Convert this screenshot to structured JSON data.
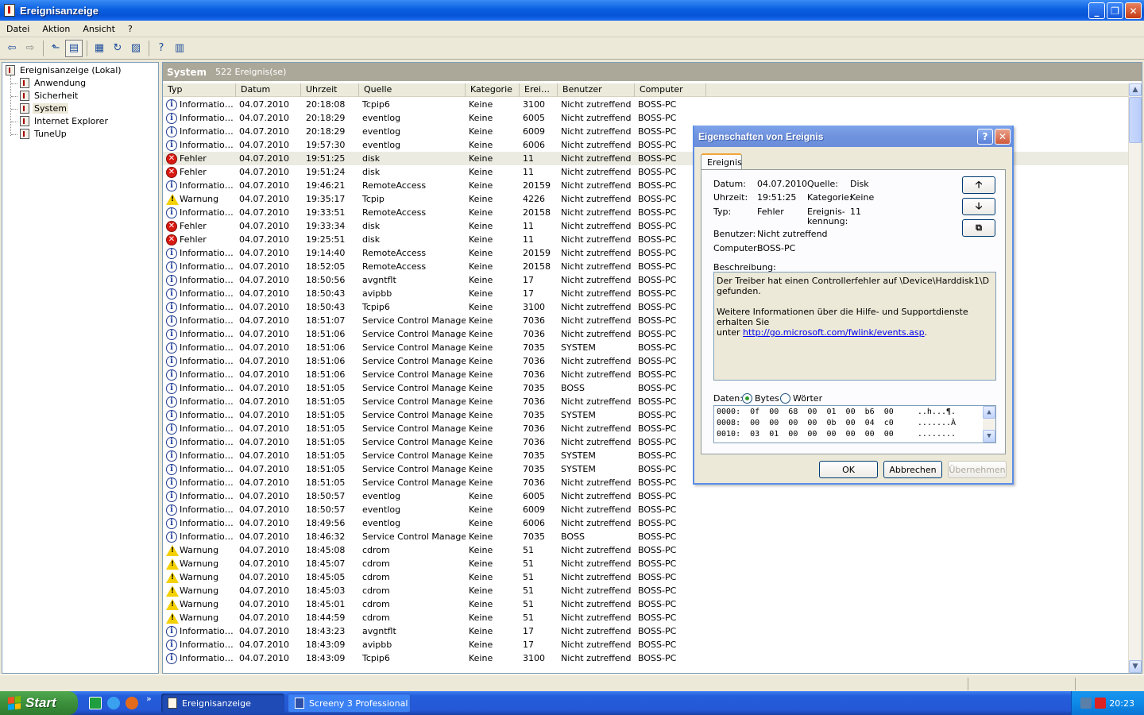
{
  "window": {
    "title": "Ereignisanzeige"
  },
  "menu": [
    "Datei",
    "Aktion",
    "Ansicht",
    "?"
  ],
  "tree": {
    "root": "Ereignisanzeige (Lokal)",
    "children": [
      "Anwendung",
      "Sicherheit",
      "System",
      "Internet Explorer",
      "TuneUp"
    ],
    "selected": "System"
  },
  "panel": {
    "name": "System",
    "count": "522 Ereignis(se)"
  },
  "columns": [
    "Typ",
    "Datum",
    "Uhrzeit",
    "Quelle",
    "Kategorie",
    "Erei…",
    "Benutzer",
    "Computer"
  ],
  "events": [
    {
      "icon": "info",
      "typ": "Informatio…",
      "datum": "04.07.2010",
      "zeit": "20:18:08",
      "quelle": "Tcpip6",
      "kat": "Keine",
      "id": "3100",
      "benutzer": "Nicht zutreffend",
      "computer": "BOSS-PC"
    },
    {
      "icon": "info",
      "typ": "Informatio…",
      "datum": "04.07.2010",
      "zeit": "20:18:29",
      "quelle": "eventlog",
      "kat": "Keine",
      "id": "6005",
      "benutzer": "Nicht zutreffend",
      "computer": "BOSS-PC"
    },
    {
      "icon": "info",
      "typ": "Informatio…",
      "datum": "04.07.2010",
      "zeit": "20:18:29",
      "quelle": "eventlog",
      "kat": "Keine",
      "id": "6009",
      "benutzer": "Nicht zutreffend",
      "computer": "BOSS-PC"
    },
    {
      "icon": "info",
      "typ": "Informatio…",
      "datum": "04.07.2010",
      "zeit": "19:57:30",
      "quelle": "eventlog",
      "kat": "Keine",
      "id": "6006",
      "benutzer": "Nicht zutreffend",
      "computer": "BOSS-PC"
    },
    {
      "icon": "err",
      "typ": "Fehler",
      "datum": "04.07.2010",
      "zeit": "19:51:25",
      "quelle": "disk",
      "kat": "Keine",
      "id": "11",
      "benutzer": "Nicht zutreffend",
      "computer": "BOSS-PC",
      "selected": true
    },
    {
      "icon": "err",
      "typ": "Fehler",
      "datum": "04.07.2010",
      "zeit": "19:51:24",
      "quelle": "disk",
      "kat": "Keine",
      "id": "11",
      "benutzer": "Nicht zutreffend",
      "computer": "BOSS-PC"
    },
    {
      "icon": "info",
      "typ": "Informatio…",
      "datum": "04.07.2010",
      "zeit": "19:46:21",
      "quelle": "RemoteAccess",
      "kat": "Keine",
      "id": "20159",
      "benutzer": "Nicht zutreffend",
      "computer": "BOSS-PC"
    },
    {
      "icon": "warn",
      "typ": "Warnung",
      "datum": "04.07.2010",
      "zeit": "19:35:17",
      "quelle": "Tcpip",
      "kat": "Keine",
      "id": "4226",
      "benutzer": "Nicht zutreffend",
      "computer": "BOSS-PC"
    },
    {
      "icon": "info",
      "typ": "Informatio…",
      "datum": "04.07.2010",
      "zeit": "19:33:51",
      "quelle": "RemoteAccess",
      "kat": "Keine",
      "id": "20158",
      "benutzer": "Nicht zutreffend",
      "computer": "BOSS-PC"
    },
    {
      "icon": "err",
      "typ": "Fehler",
      "datum": "04.07.2010",
      "zeit": "19:33:34",
      "quelle": "disk",
      "kat": "Keine",
      "id": "11",
      "benutzer": "Nicht zutreffend",
      "computer": "BOSS-PC"
    },
    {
      "icon": "err",
      "typ": "Fehler",
      "datum": "04.07.2010",
      "zeit": "19:25:51",
      "quelle": "disk",
      "kat": "Keine",
      "id": "11",
      "benutzer": "Nicht zutreffend",
      "computer": "BOSS-PC"
    },
    {
      "icon": "info",
      "typ": "Informatio…",
      "datum": "04.07.2010",
      "zeit": "19:14:40",
      "quelle": "RemoteAccess",
      "kat": "Keine",
      "id": "20159",
      "benutzer": "Nicht zutreffend",
      "computer": "BOSS-PC"
    },
    {
      "icon": "info",
      "typ": "Informatio…",
      "datum": "04.07.2010",
      "zeit": "18:52:05",
      "quelle": "RemoteAccess",
      "kat": "Keine",
      "id": "20158",
      "benutzer": "Nicht zutreffend",
      "computer": "BOSS-PC"
    },
    {
      "icon": "info",
      "typ": "Informatio…",
      "datum": "04.07.2010",
      "zeit": "18:50:56",
      "quelle": "avgntflt",
      "kat": "Keine",
      "id": "17",
      "benutzer": "Nicht zutreffend",
      "computer": "BOSS-PC"
    },
    {
      "icon": "info",
      "typ": "Informatio…",
      "datum": "04.07.2010",
      "zeit": "18:50:43",
      "quelle": "avipbb",
      "kat": "Keine",
      "id": "17",
      "benutzer": "Nicht zutreffend",
      "computer": "BOSS-PC"
    },
    {
      "icon": "info",
      "typ": "Informatio…",
      "datum": "04.07.2010",
      "zeit": "18:50:43",
      "quelle": "Tcpip6",
      "kat": "Keine",
      "id": "3100",
      "benutzer": "Nicht zutreffend",
      "computer": "BOSS-PC"
    },
    {
      "icon": "info",
      "typ": "Informatio…",
      "datum": "04.07.2010",
      "zeit": "18:51:07",
      "quelle": "Service Control Manager",
      "kat": "Keine",
      "id": "7036",
      "benutzer": "Nicht zutreffend",
      "computer": "BOSS-PC"
    },
    {
      "icon": "info",
      "typ": "Informatio…",
      "datum": "04.07.2010",
      "zeit": "18:51:06",
      "quelle": "Service Control Manager",
      "kat": "Keine",
      "id": "7036",
      "benutzer": "Nicht zutreffend",
      "computer": "BOSS-PC"
    },
    {
      "icon": "info",
      "typ": "Informatio…",
      "datum": "04.07.2010",
      "zeit": "18:51:06",
      "quelle": "Service Control Manager",
      "kat": "Keine",
      "id": "7035",
      "benutzer": "SYSTEM",
      "computer": "BOSS-PC"
    },
    {
      "icon": "info",
      "typ": "Informatio…",
      "datum": "04.07.2010",
      "zeit": "18:51:06",
      "quelle": "Service Control Manager",
      "kat": "Keine",
      "id": "7036",
      "benutzer": "Nicht zutreffend",
      "computer": "BOSS-PC"
    },
    {
      "icon": "info",
      "typ": "Informatio…",
      "datum": "04.07.2010",
      "zeit": "18:51:06",
      "quelle": "Service Control Manager",
      "kat": "Keine",
      "id": "7036",
      "benutzer": "Nicht zutreffend",
      "computer": "BOSS-PC"
    },
    {
      "icon": "info",
      "typ": "Informatio…",
      "datum": "04.07.2010",
      "zeit": "18:51:05",
      "quelle": "Service Control Manager",
      "kat": "Keine",
      "id": "7035",
      "benutzer": "BOSS",
      "computer": "BOSS-PC"
    },
    {
      "icon": "info",
      "typ": "Informatio…",
      "datum": "04.07.2010",
      "zeit": "18:51:05",
      "quelle": "Service Control Manager",
      "kat": "Keine",
      "id": "7036",
      "benutzer": "Nicht zutreffend",
      "computer": "BOSS-PC"
    },
    {
      "icon": "info",
      "typ": "Informatio…",
      "datum": "04.07.2010",
      "zeit": "18:51:05",
      "quelle": "Service Control Manager",
      "kat": "Keine",
      "id": "7035",
      "benutzer": "SYSTEM",
      "computer": "BOSS-PC"
    },
    {
      "icon": "info",
      "typ": "Informatio…",
      "datum": "04.07.2010",
      "zeit": "18:51:05",
      "quelle": "Service Control Manager",
      "kat": "Keine",
      "id": "7036",
      "benutzer": "Nicht zutreffend",
      "computer": "BOSS-PC"
    },
    {
      "icon": "info",
      "typ": "Informatio…",
      "datum": "04.07.2010",
      "zeit": "18:51:05",
      "quelle": "Service Control Manager",
      "kat": "Keine",
      "id": "7036",
      "benutzer": "Nicht zutreffend",
      "computer": "BOSS-PC"
    },
    {
      "icon": "info",
      "typ": "Informatio…",
      "datum": "04.07.2010",
      "zeit": "18:51:05",
      "quelle": "Service Control Manager",
      "kat": "Keine",
      "id": "7035",
      "benutzer": "SYSTEM",
      "computer": "BOSS-PC"
    },
    {
      "icon": "info",
      "typ": "Informatio…",
      "datum": "04.07.2010",
      "zeit": "18:51:05",
      "quelle": "Service Control Manager",
      "kat": "Keine",
      "id": "7035",
      "benutzer": "SYSTEM",
      "computer": "BOSS-PC"
    },
    {
      "icon": "info",
      "typ": "Informatio…",
      "datum": "04.07.2010",
      "zeit": "18:51:05",
      "quelle": "Service Control Manager",
      "kat": "Keine",
      "id": "7036",
      "benutzer": "Nicht zutreffend",
      "computer": "BOSS-PC"
    },
    {
      "icon": "info",
      "typ": "Informatio…",
      "datum": "04.07.2010",
      "zeit": "18:50:57",
      "quelle": "eventlog",
      "kat": "Keine",
      "id": "6005",
      "benutzer": "Nicht zutreffend",
      "computer": "BOSS-PC"
    },
    {
      "icon": "info",
      "typ": "Informatio…",
      "datum": "04.07.2010",
      "zeit": "18:50:57",
      "quelle": "eventlog",
      "kat": "Keine",
      "id": "6009",
      "benutzer": "Nicht zutreffend",
      "computer": "BOSS-PC"
    },
    {
      "icon": "info",
      "typ": "Informatio…",
      "datum": "04.07.2010",
      "zeit": "18:49:56",
      "quelle": "eventlog",
      "kat": "Keine",
      "id": "6006",
      "benutzer": "Nicht zutreffend",
      "computer": "BOSS-PC"
    },
    {
      "icon": "info",
      "typ": "Informatio…",
      "datum": "04.07.2010",
      "zeit": "18:46:32",
      "quelle": "Service Control Manager",
      "kat": "Keine",
      "id": "7035",
      "benutzer": "BOSS",
      "computer": "BOSS-PC"
    },
    {
      "icon": "warn",
      "typ": "Warnung",
      "datum": "04.07.2010",
      "zeit": "18:45:08",
      "quelle": "cdrom",
      "kat": "Keine",
      "id": "51",
      "benutzer": "Nicht zutreffend",
      "computer": "BOSS-PC"
    },
    {
      "icon": "warn",
      "typ": "Warnung",
      "datum": "04.07.2010",
      "zeit": "18:45:07",
      "quelle": "cdrom",
      "kat": "Keine",
      "id": "51",
      "benutzer": "Nicht zutreffend",
      "computer": "BOSS-PC"
    },
    {
      "icon": "warn",
      "typ": "Warnung",
      "datum": "04.07.2010",
      "zeit": "18:45:05",
      "quelle": "cdrom",
      "kat": "Keine",
      "id": "51",
      "benutzer": "Nicht zutreffend",
      "computer": "BOSS-PC"
    },
    {
      "icon": "warn",
      "typ": "Warnung",
      "datum": "04.07.2010",
      "zeit": "18:45:03",
      "quelle": "cdrom",
      "kat": "Keine",
      "id": "51",
      "benutzer": "Nicht zutreffend",
      "computer": "BOSS-PC"
    },
    {
      "icon": "warn",
      "typ": "Warnung",
      "datum": "04.07.2010",
      "zeit": "18:45:01",
      "quelle": "cdrom",
      "kat": "Keine",
      "id": "51",
      "benutzer": "Nicht zutreffend",
      "computer": "BOSS-PC"
    },
    {
      "icon": "warn",
      "typ": "Warnung",
      "datum": "04.07.2010",
      "zeit": "18:44:59",
      "quelle": "cdrom",
      "kat": "Keine",
      "id": "51",
      "benutzer": "Nicht zutreffend",
      "computer": "BOSS-PC"
    },
    {
      "icon": "info",
      "typ": "Informatio…",
      "datum": "04.07.2010",
      "zeit": "18:43:23",
      "quelle": "avgntflt",
      "kat": "Keine",
      "id": "17",
      "benutzer": "Nicht zutreffend",
      "computer": "BOSS-PC"
    },
    {
      "icon": "info",
      "typ": "Informatio…",
      "datum": "04.07.2010",
      "zeit": "18:43:09",
      "quelle": "avipbb",
      "kat": "Keine",
      "id": "17",
      "benutzer": "Nicht zutreffend",
      "computer": "BOSS-PC"
    },
    {
      "icon": "info",
      "typ": "Informatio…",
      "datum": "04.07.2010",
      "zeit": "18:43:09",
      "quelle": "Tcpip6",
      "kat": "Keine",
      "id": "3100",
      "benutzer": "Nicht zutreffend",
      "computer": "BOSS-PC"
    }
  ],
  "dialog": {
    "title": "Eigenschaften von Ereignis",
    "help_glyph": "?",
    "close_glyph": "✕",
    "tab": "Ereignis",
    "labels": {
      "datum": "Datum:",
      "uhrzeit": "Uhrzeit:",
      "typ": "Typ:",
      "benutzer": "Benutzer:",
      "computer": "Computer:",
      "quelle": "Quelle:",
      "kategorie": "Kategorie:",
      "kennung_1": "Ereignis-",
      "kennung_2": "kennung:",
      "beschreibung": "Beschreibung:",
      "daten": "Daten:",
      "bytes": "Bytes",
      "woerter": "Wörter"
    },
    "values": {
      "datum": "04.07.2010",
      "uhrzeit": "19:51:25",
      "typ": "Fehler",
      "benutzer": "Nicht zutreffend",
      "computer": "BOSS-PC",
      "quelle": "Disk",
      "kategorie": "Keine",
      "kennung": "11"
    },
    "description": {
      "line1": "Der Treiber hat einen Controllerfehler auf \\Device\\Harddisk1\\D gefunden.",
      "line2": "Weitere Informationen über die Hilfe- und Supportdienste erhalten Sie",
      "line3_prefix": "unter ",
      "link": "http://go.microsoft.com/fwlink/events.asp",
      "line3_suffix": "."
    },
    "data_format": "Bytes",
    "hex": [
      "0000:  0f  00  68  00  01  00  b6  00     ..h...¶.",
      "0008:  00  00  00  00  0b  00  04  c0     .......À",
      "0010:  03  01  00  00  00  00  00  00     ........"
    ],
    "buttons": {
      "ok": "OK",
      "cancel": "Abbrechen",
      "apply": "Übernehmen"
    }
  },
  "taskbar": {
    "start": "Start",
    "tasks": [
      "Ereignisanzeige",
      "Screeny 3 Professional"
    ],
    "clock": "20:23",
    "overflow": "»"
  }
}
